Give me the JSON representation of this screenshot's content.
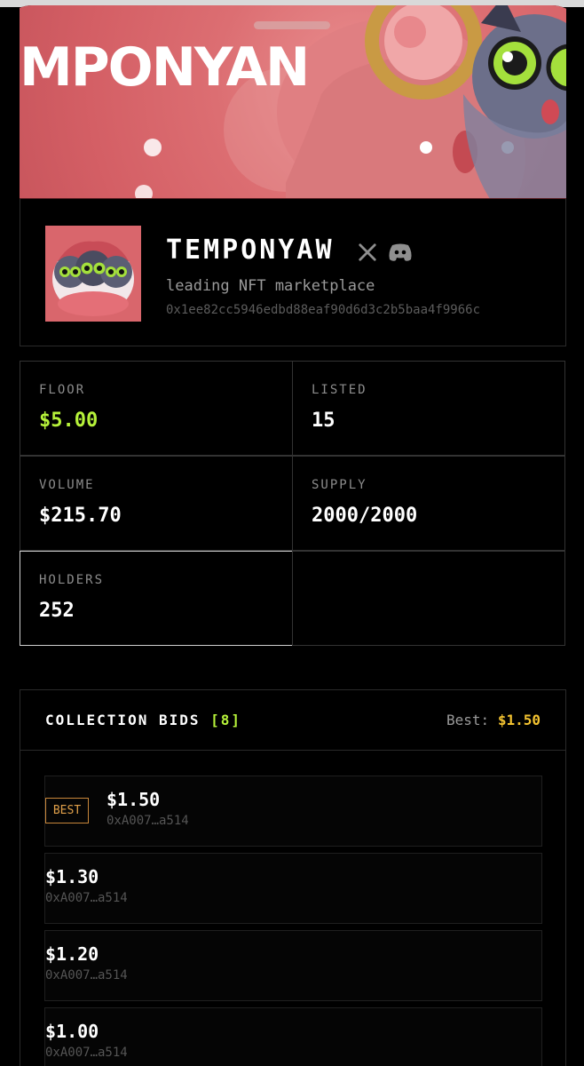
{
  "banner": {
    "title": "MPONYAN"
  },
  "collection": {
    "name": "TEMPONYAW",
    "tagline": "leading NFT marketplace",
    "address": "0x1ee82cc5946edbd88eaf90d6d3c2b5baa4f9966c",
    "social_icons": [
      "x-icon",
      "discord-icon"
    ]
  },
  "stats": {
    "floor": {
      "label": "FLOOR",
      "value": "$5.00"
    },
    "listed": {
      "label": "LISTED",
      "value": "15"
    },
    "volume": {
      "label": "VOLUME",
      "value": "$215.70"
    },
    "supply": {
      "label": "SUPPLY",
      "value": "2000/2000"
    },
    "holders": {
      "label": "HOLDERS",
      "value": "252"
    }
  },
  "bids": {
    "title": "COLLECTION BIDS",
    "count": "[8]",
    "best_label": "Best:",
    "best_value": "$1.50",
    "badge": "BEST",
    "items": [
      {
        "amount": "$1.50",
        "address": "0xA007…a514"
      },
      {
        "amount": "$1.30",
        "address": "0xA007…a514"
      },
      {
        "amount": "$1.20",
        "address": "0xA007…a514"
      },
      {
        "amount": "$1.00",
        "address": "0xA007…a514"
      }
    ]
  },
  "colors": {
    "accent_green": "#b6f23a",
    "accent_gold": "#f2c230",
    "banner_pink": "#d45f65"
  }
}
